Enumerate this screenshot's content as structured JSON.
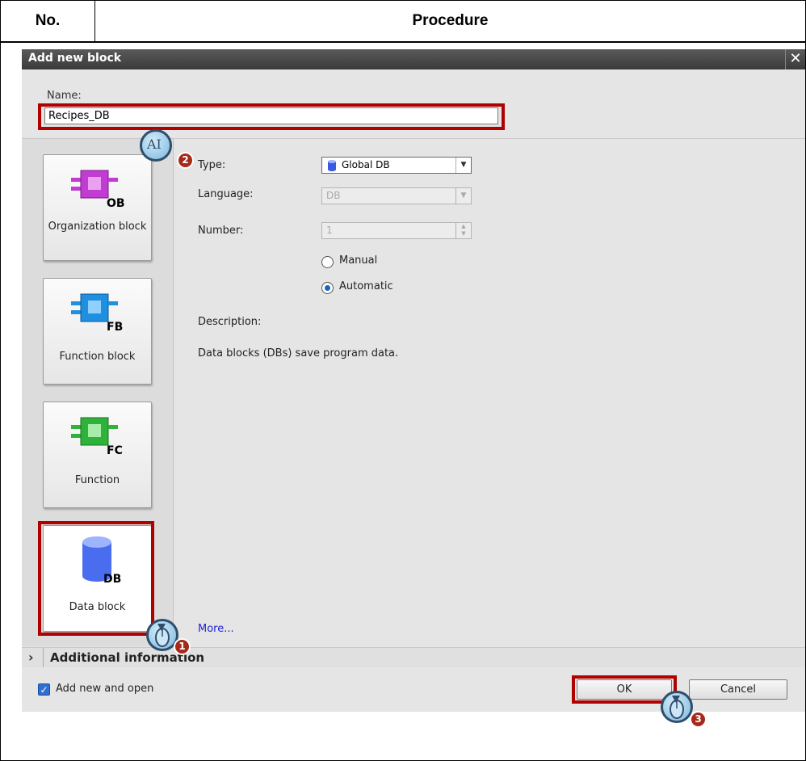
{
  "table": {
    "col_no": "No.",
    "col_procedure": "Procedure"
  },
  "dialog": {
    "title": "Add new block",
    "close_glyph": "✕",
    "name_label": "Name:",
    "name_value": "Recipes_DB",
    "block_buttons": [
      {
        "tag": "OB",
        "label": "Organization block",
        "color": "#c23cd4"
      },
      {
        "tag": "FB",
        "label": "Function block",
        "color": "#1f8fe0"
      },
      {
        "tag": "FC",
        "label": "Function",
        "color": "#2fb23a"
      },
      {
        "tag": "DB",
        "label": "Data block",
        "color": "#4a6df0"
      }
    ],
    "type_label": "Type:",
    "type_value": "Global DB",
    "language_label": "Language:",
    "language_value": "DB",
    "number_label": "Number:",
    "number_value": "1",
    "radio_manual": "Manual",
    "radio_automatic": "Automatic",
    "selected_radio": "Automatic",
    "description_label": "Description:",
    "description_text": "Data blocks (DBs) save program data.",
    "more_link": "More...",
    "additional_info": "Additional information",
    "add_new_and_open": "Add new and open",
    "add_new_and_open_checked": true,
    "ok_label": "OK",
    "cancel_label": "Cancel"
  },
  "markers": {
    "step1": "1",
    "step2": "2",
    "step3": "3",
    "ai_glyph": "AI"
  }
}
